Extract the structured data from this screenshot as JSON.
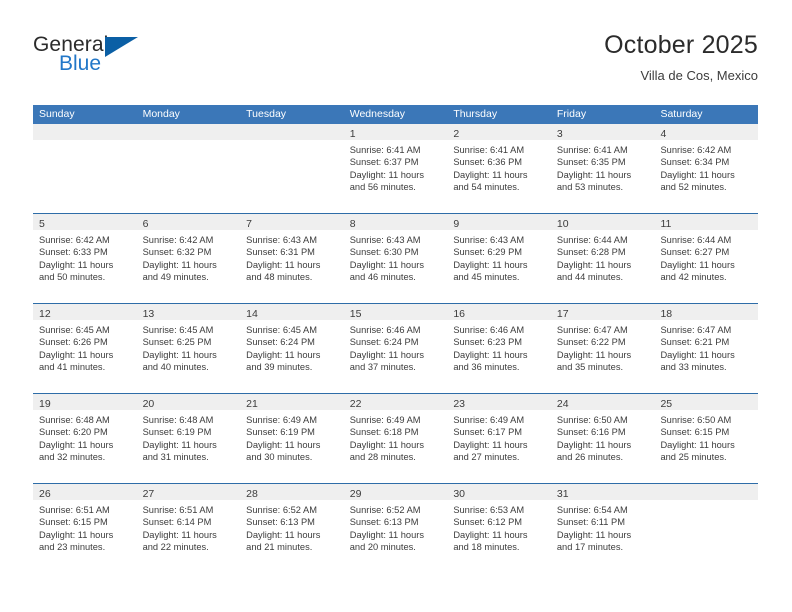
{
  "logo": {
    "text_primary": "General",
    "text_secondary": "Blue",
    "triangle_icon": "triangle-icon",
    "primary_color": "#2b2b2b",
    "secondary_color": "#2277c8",
    "triangle_color": "#0b5fa5"
  },
  "header": {
    "title": "October 2025",
    "subtitle": "Villa de Cos, Mexico"
  },
  "theme": {
    "header_row_bg": "#3b77b8",
    "header_row_text": "#ffffff",
    "week_divider": "#2e6da8",
    "daynum_band_bg": "#efefef",
    "body_text": "#3c3c3c"
  },
  "weekdays": [
    "Sunday",
    "Monday",
    "Tuesday",
    "Wednesday",
    "Thursday",
    "Friday",
    "Saturday"
  ],
  "weeks": [
    [
      {
        "day": "",
        "sunrise": "",
        "sunset": "",
        "daylight_line1": "",
        "daylight_line2": "",
        "empty": true
      },
      {
        "day": "",
        "sunrise": "",
        "sunset": "",
        "daylight_line1": "",
        "daylight_line2": "",
        "empty": true
      },
      {
        "day": "",
        "sunrise": "",
        "sunset": "",
        "daylight_line1": "",
        "daylight_line2": "",
        "empty": true
      },
      {
        "day": "1",
        "sunrise": "Sunrise: 6:41 AM",
        "sunset": "Sunset: 6:37 PM",
        "daylight_line1": "Daylight: 11 hours",
        "daylight_line2": "and 56 minutes.",
        "empty": false
      },
      {
        "day": "2",
        "sunrise": "Sunrise: 6:41 AM",
        "sunset": "Sunset: 6:36 PM",
        "daylight_line1": "Daylight: 11 hours",
        "daylight_line2": "and 54 minutes.",
        "empty": false
      },
      {
        "day": "3",
        "sunrise": "Sunrise: 6:41 AM",
        "sunset": "Sunset: 6:35 PM",
        "daylight_line1": "Daylight: 11 hours",
        "daylight_line2": "and 53 minutes.",
        "empty": false
      },
      {
        "day": "4",
        "sunrise": "Sunrise: 6:42 AM",
        "sunset": "Sunset: 6:34 PM",
        "daylight_line1": "Daylight: 11 hours",
        "daylight_line2": "and 52 minutes.",
        "empty": false
      }
    ],
    [
      {
        "day": "5",
        "sunrise": "Sunrise: 6:42 AM",
        "sunset": "Sunset: 6:33 PM",
        "daylight_line1": "Daylight: 11 hours",
        "daylight_line2": "and 50 minutes.",
        "empty": false
      },
      {
        "day": "6",
        "sunrise": "Sunrise: 6:42 AM",
        "sunset": "Sunset: 6:32 PM",
        "daylight_line1": "Daylight: 11 hours",
        "daylight_line2": "and 49 minutes.",
        "empty": false
      },
      {
        "day": "7",
        "sunrise": "Sunrise: 6:43 AM",
        "sunset": "Sunset: 6:31 PM",
        "daylight_line1": "Daylight: 11 hours",
        "daylight_line2": "and 48 minutes.",
        "empty": false
      },
      {
        "day": "8",
        "sunrise": "Sunrise: 6:43 AM",
        "sunset": "Sunset: 6:30 PM",
        "daylight_line1": "Daylight: 11 hours",
        "daylight_line2": "and 46 minutes.",
        "empty": false
      },
      {
        "day": "9",
        "sunrise": "Sunrise: 6:43 AM",
        "sunset": "Sunset: 6:29 PM",
        "daylight_line1": "Daylight: 11 hours",
        "daylight_line2": "and 45 minutes.",
        "empty": false
      },
      {
        "day": "10",
        "sunrise": "Sunrise: 6:44 AM",
        "sunset": "Sunset: 6:28 PM",
        "daylight_line1": "Daylight: 11 hours",
        "daylight_line2": "and 44 minutes.",
        "empty": false
      },
      {
        "day": "11",
        "sunrise": "Sunrise: 6:44 AM",
        "sunset": "Sunset: 6:27 PM",
        "daylight_line1": "Daylight: 11 hours",
        "daylight_line2": "and 42 minutes.",
        "empty": false
      }
    ],
    [
      {
        "day": "12",
        "sunrise": "Sunrise: 6:45 AM",
        "sunset": "Sunset: 6:26 PM",
        "daylight_line1": "Daylight: 11 hours",
        "daylight_line2": "and 41 minutes.",
        "empty": false
      },
      {
        "day": "13",
        "sunrise": "Sunrise: 6:45 AM",
        "sunset": "Sunset: 6:25 PM",
        "daylight_line1": "Daylight: 11 hours",
        "daylight_line2": "and 40 minutes.",
        "empty": false
      },
      {
        "day": "14",
        "sunrise": "Sunrise: 6:45 AM",
        "sunset": "Sunset: 6:24 PM",
        "daylight_line1": "Daylight: 11 hours",
        "daylight_line2": "and 39 minutes.",
        "empty": false
      },
      {
        "day": "15",
        "sunrise": "Sunrise: 6:46 AM",
        "sunset": "Sunset: 6:24 PM",
        "daylight_line1": "Daylight: 11 hours",
        "daylight_line2": "and 37 minutes.",
        "empty": false
      },
      {
        "day": "16",
        "sunrise": "Sunrise: 6:46 AM",
        "sunset": "Sunset: 6:23 PM",
        "daylight_line1": "Daylight: 11 hours",
        "daylight_line2": "and 36 minutes.",
        "empty": false
      },
      {
        "day": "17",
        "sunrise": "Sunrise: 6:47 AM",
        "sunset": "Sunset: 6:22 PM",
        "daylight_line1": "Daylight: 11 hours",
        "daylight_line2": "and 35 minutes.",
        "empty": false
      },
      {
        "day": "18",
        "sunrise": "Sunrise: 6:47 AM",
        "sunset": "Sunset: 6:21 PM",
        "daylight_line1": "Daylight: 11 hours",
        "daylight_line2": "and 33 minutes.",
        "empty": false
      }
    ],
    [
      {
        "day": "19",
        "sunrise": "Sunrise: 6:48 AM",
        "sunset": "Sunset: 6:20 PM",
        "daylight_line1": "Daylight: 11 hours",
        "daylight_line2": "and 32 minutes.",
        "empty": false
      },
      {
        "day": "20",
        "sunrise": "Sunrise: 6:48 AM",
        "sunset": "Sunset: 6:19 PM",
        "daylight_line1": "Daylight: 11 hours",
        "daylight_line2": "and 31 minutes.",
        "empty": false
      },
      {
        "day": "21",
        "sunrise": "Sunrise: 6:49 AM",
        "sunset": "Sunset: 6:19 PM",
        "daylight_line1": "Daylight: 11 hours",
        "daylight_line2": "and 30 minutes.",
        "empty": false
      },
      {
        "day": "22",
        "sunrise": "Sunrise: 6:49 AM",
        "sunset": "Sunset: 6:18 PM",
        "daylight_line1": "Daylight: 11 hours",
        "daylight_line2": "and 28 minutes.",
        "empty": false
      },
      {
        "day": "23",
        "sunrise": "Sunrise: 6:49 AM",
        "sunset": "Sunset: 6:17 PM",
        "daylight_line1": "Daylight: 11 hours",
        "daylight_line2": "and 27 minutes.",
        "empty": false
      },
      {
        "day": "24",
        "sunrise": "Sunrise: 6:50 AM",
        "sunset": "Sunset: 6:16 PM",
        "daylight_line1": "Daylight: 11 hours",
        "daylight_line2": "and 26 minutes.",
        "empty": false
      },
      {
        "day": "25",
        "sunrise": "Sunrise: 6:50 AM",
        "sunset": "Sunset: 6:15 PM",
        "daylight_line1": "Daylight: 11 hours",
        "daylight_line2": "and 25 minutes.",
        "empty": false
      }
    ],
    [
      {
        "day": "26",
        "sunrise": "Sunrise: 6:51 AM",
        "sunset": "Sunset: 6:15 PM",
        "daylight_line1": "Daylight: 11 hours",
        "daylight_line2": "and 23 minutes.",
        "empty": false
      },
      {
        "day": "27",
        "sunrise": "Sunrise: 6:51 AM",
        "sunset": "Sunset: 6:14 PM",
        "daylight_line1": "Daylight: 11 hours",
        "daylight_line2": "and 22 minutes.",
        "empty": false
      },
      {
        "day": "28",
        "sunrise": "Sunrise: 6:52 AM",
        "sunset": "Sunset: 6:13 PM",
        "daylight_line1": "Daylight: 11 hours",
        "daylight_line2": "and 21 minutes.",
        "empty": false
      },
      {
        "day": "29",
        "sunrise": "Sunrise: 6:52 AM",
        "sunset": "Sunset: 6:13 PM",
        "daylight_line1": "Daylight: 11 hours",
        "daylight_line2": "and 20 minutes.",
        "empty": false
      },
      {
        "day": "30",
        "sunrise": "Sunrise: 6:53 AM",
        "sunset": "Sunset: 6:12 PM",
        "daylight_line1": "Daylight: 11 hours",
        "daylight_line2": "and 18 minutes.",
        "empty": false
      },
      {
        "day": "31",
        "sunrise": "Sunrise: 6:54 AM",
        "sunset": "Sunset: 6:11 PM",
        "daylight_line1": "Daylight: 11 hours",
        "daylight_line2": "and 17 minutes.",
        "empty": false
      },
      {
        "day": "",
        "sunrise": "",
        "sunset": "",
        "daylight_line1": "",
        "daylight_line2": "",
        "empty": true
      }
    ]
  ]
}
